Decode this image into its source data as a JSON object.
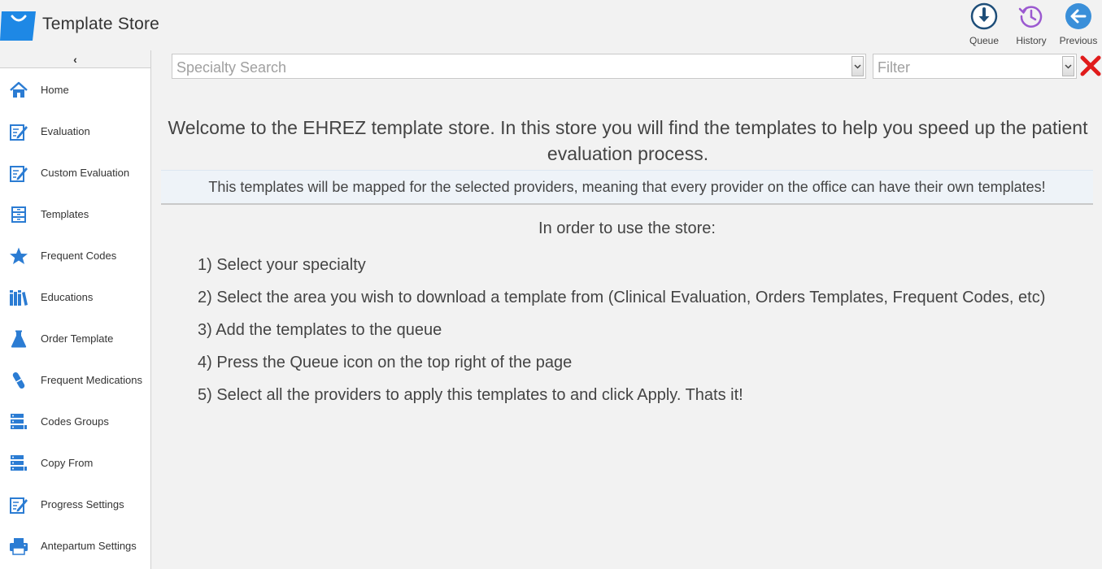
{
  "app": {
    "title": "Template Store"
  },
  "top_actions": [
    {
      "label": "Queue",
      "icon": "queue-download-icon",
      "color": "#1e4e79"
    },
    {
      "label": "History",
      "icon": "history-icon",
      "color": "#9b59d0"
    },
    {
      "label": "Previous",
      "icon": "back-arrow-icon",
      "color": "#3a8fd9"
    }
  ],
  "sidebar": {
    "collapse_glyph": "‹",
    "items": [
      {
        "label": "Home",
        "icon": "home-icon"
      },
      {
        "label": "Evaluation",
        "icon": "edit-form-icon"
      },
      {
        "label": "Custom Evaluation",
        "icon": "edit-form-icon"
      },
      {
        "label": "Templates",
        "icon": "file-cabinet-icon"
      },
      {
        "label": "Frequent Codes",
        "icon": "star-icon"
      },
      {
        "label": "Educations",
        "icon": "books-icon"
      },
      {
        "label": "Order Template",
        "icon": "flask-icon"
      },
      {
        "label": "Frequent Medications",
        "icon": "pill-icon"
      },
      {
        "label": "Codes Groups",
        "icon": "server-stack-icon"
      },
      {
        "label": "Copy From",
        "icon": "server-stack-icon"
      },
      {
        "label": "Progress Settings",
        "icon": "edit-form-icon"
      },
      {
        "label": "Antepartum Settings",
        "icon": "printer-icon"
      }
    ]
  },
  "search": {
    "placeholder": "Specialty Search"
  },
  "filter": {
    "placeholder": "Filter"
  },
  "main": {
    "welcome": "Welcome to the EHREZ template store. In this store you will find the templates to help you speed up the patient evaluation process.",
    "notice": "This templates will be mapped for the selected providers, meaning that every provider on the office can have their own templates!",
    "subhead": "In order to use the store:",
    "steps": [
      "1) Select your specialty",
      "2) Select the area you wish to download a template from (Clinical Evaluation, Orders Templates, Frequent Codes, etc)",
      "3) Add the templates to the queue",
      "4) Press the Queue icon on the top right of the page",
      "5) Select all the providers to apply this templates to and click Apply. Thats it!"
    ]
  },
  "colors": {
    "accent": "#2b7cd3",
    "clear": "#e01b1b"
  }
}
